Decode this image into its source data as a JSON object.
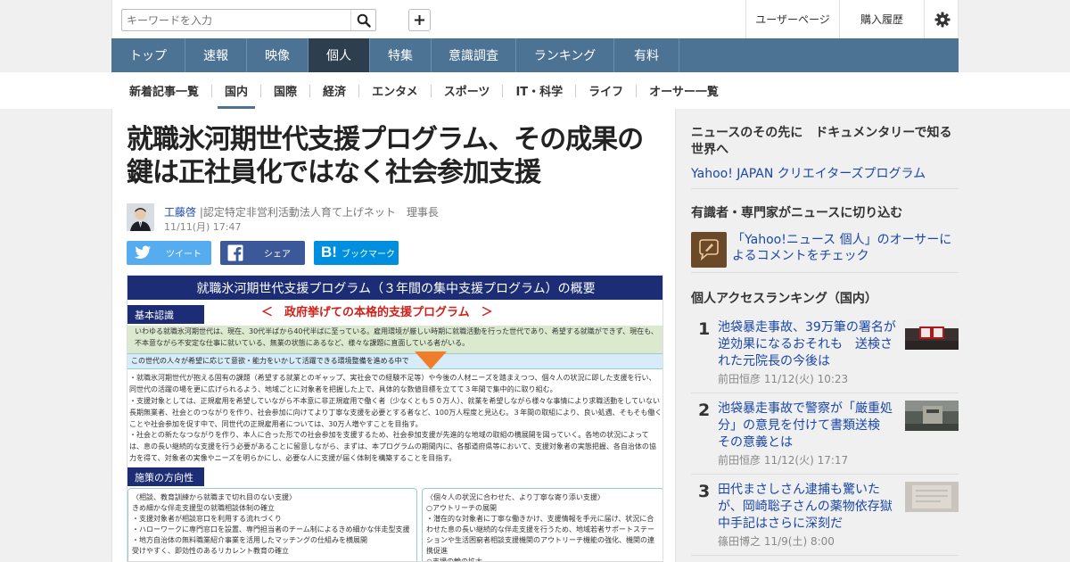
{
  "header": {
    "search_placeholder": "キーワードを入力",
    "links": [
      "ユーザーページ",
      "購入履歴"
    ]
  },
  "nav": {
    "tabs": [
      "トップ",
      "速報",
      "映像",
      "個人",
      "特集",
      "意識調査",
      "ランキング",
      "有料"
    ],
    "active": "個人"
  },
  "subnav": {
    "items": [
      "新着記事一覧",
      "国内",
      "国際",
      "経済",
      "エンタメ",
      "スポーツ",
      "IT・科学",
      "ライフ",
      "オーサー一覧"
    ],
    "active": "国内"
  },
  "article": {
    "title": "就職氷河期世代支援プログラム、その成果の鍵は正社員化ではなく社会参加支援",
    "author_name": "工藤啓",
    "author_desc": "|認定特定非営利活動法人育て上げネット　理事長",
    "date": "11/11(月) 17:47",
    "share": {
      "tweet": "ツイート",
      "facebook": "シェア",
      "hatena": "ブックマーク"
    },
    "figure": {
      "heading": "就職氷河期世代支援プログラム（３年間の集中支援プログラム）の概要",
      "tag1": "基本認識",
      "subtitle": "＜　政府挙げての本格的支援プログラム　＞",
      "para1": "いわゆる就職氷河期世代は、現在、30代半ばから40代半ばに至っている。雇用環境が厳しい時期に就職活動を行った世代であり、希望する就職ができず、現在も、不本意ながら不安定な仕事に就いている、無業の状態にあるなど、様々な課題に直面している者がいる。",
      "blue": "この世代の人々が希望に応じて意欲・能力をいかして活躍できる環境整備を進める中で",
      "para2": "・就職氷河期世代が抱える固有の課題（希望する就業とのギャップ、実社会での経験不足等）や今後の人材ニーズを踏まえつつ、個々人の状況に即した支援を行い、同世代の活躍の場を更に広げられるよう、地域ごとに対象者を把握した上で、具体的な数値目標を立てて３年間で集中的に取り組む。",
      "para3": "・支援対象としては、正規雇用を希望していながら不本意に非正規雇用で働く者（少なくとも５０万人）、就業を希望しながら様々な事情により求職活動をしていない長期無業者、社会とのつながりを作り、社会参加に向けてより丁寧な支援を必要とする者など、100万人程度と見込む。３年間の取組により、良い処遇、そもそも働くことや社会参加を促す中で、同世代の正規雇用者については、30万人増やすことを目指す。",
      "para4": "・社会との新たなつながりを作り、本人に合った形での社会参加を支援するため、社会参加支援が先進的な地域の取組の横展開を図っていく。各地の状況によっては、息の長い継続的な支援を行う必要があることに留意しながら、まずは、本プログラムの期間内に、各都道府県等において、支援対象者の実態把握、各自治体の協力を得て、対象者の実像やニーズを明らかにし、必要な人に支援が届く体制を構築することを目指す。",
      "tag2": "施策の方向性",
      "col1": "〈相談、教育訓練から就職まで切れ目のない支援〉\nきめ細かな伴走支援型の就職相談体制の確立\n・支援対象者が相談窓口を利用する流れづくり\n・ハローワークに専門窓口を設置、専門担当者のチーム制によるきめ細かな伴走型支援\n・地方自治体の無料職業紹介事業を活用したマッチングの仕組みを横展開\n受けやすく、即効性のあるリカレント教育の確立",
      "col2": "〈個々人の状況に合わせた、より丁寧な寄り添い支援〉\n○アウトリーチの展開\n・潜在的な対象者に丁寧な働きかけ、支援情報を手元に届け、状況に合わせた息の長い継続的な伴走支援を行うため、地域若者サポートステーションや生活困窮者相談支援機関のアウトリーチ機能の強化、機関の連携促進\n○支援の輪の拡大"
    }
  },
  "sidebar": {
    "block1_heading": "ニュースのその先に　ドキュメンタリーで知る世界へ",
    "block1_link": "Yahoo! JAPAN クリエイターズプログラム",
    "block2_heading": "有識者・専門家がニュースに切り込む",
    "block2_link": "「Yahoo!ニュース 個人」のオーサーによるコメントをチェック",
    "ranking_heading": "個人アクセスランキング（国内）",
    "ranking": [
      {
        "rank": "1",
        "title": "池袋暴走事故、39万筆の署名が逆効果になるおそれも　送検された元院長の今後は",
        "meta": "前田恒彦 11/12(火) 10:23"
      },
      {
        "rank": "2",
        "title": "池袋暴走事故で警察が「厳重処分」の意見を付けて書類送検　その意義とは",
        "meta": "前田恒彦 11/12(火) 17:17"
      },
      {
        "rank": "3",
        "title": "田代まさしさん逮捕も驚いたが、岡崎聡子さんの薬物依存獄中手記はさらに深刻だ",
        "meta": "篠田博之 11/9(土) 8:00"
      }
    ]
  }
}
